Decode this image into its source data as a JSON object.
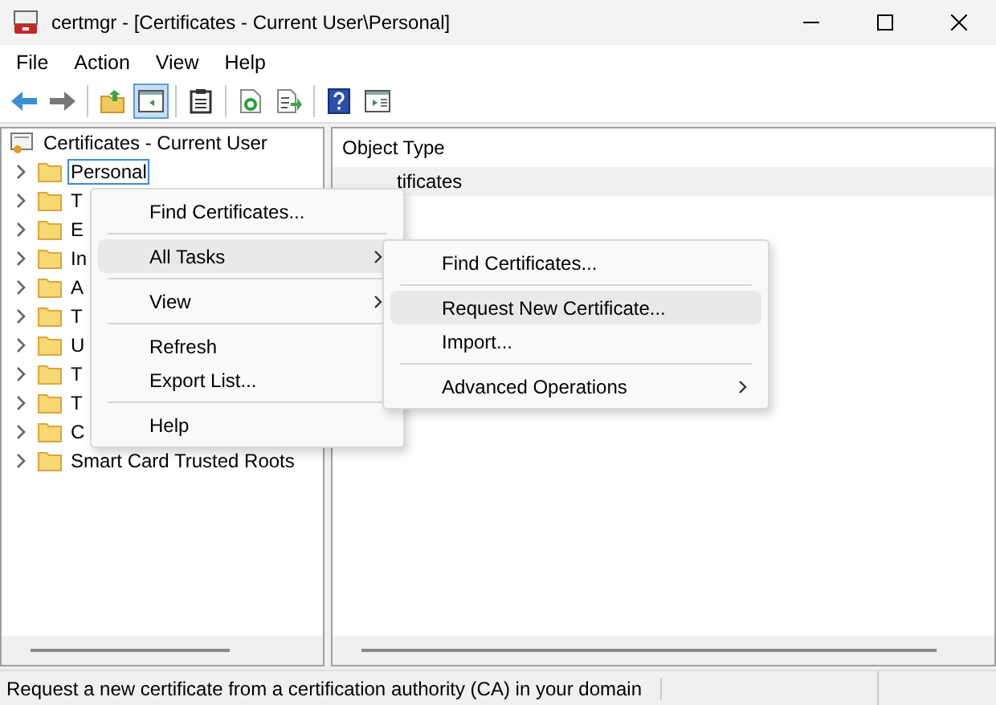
{
  "window": {
    "title": "certmgr - [Certificates - Current User\\Personal]"
  },
  "menu_bar": [
    {
      "label": "File"
    },
    {
      "label": "Action"
    },
    {
      "label": "View"
    },
    {
      "label": "Help"
    }
  ],
  "toolbar": [
    {
      "kind": "back",
      "pressed": false
    },
    {
      "kind": "forward",
      "pressed": false
    },
    {
      "kind": "separator"
    },
    {
      "kind": "up",
      "pressed": false
    },
    {
      "kind": "tree",
      "pressed": true
    },
    {
      "kind": "separator"
    },
    {
      "kind": "clipboard",
      "pressed": false
    },
    {
      "kind": "separator"
    },
    {
      "kind": "refresh",
      "pressed": false
    },
    {
      "kind": "export",
      "pressed": false
    },
    {
      "kind": "separator"
    },
    {
      "kind": "help",
      "pressed": false
    },
    {
      "kind": "pane",
      "pressed": false
    }
  ],
  "tree": {
    "root": "Certificates - Current User",
    "children": [
      {
        "label": "Personal",
        "selected": true
      },
      {
        "label": "T",
        "selected": false
      },
      {
        "label": "E",
        "selected": false
      },
      {
        "label": "In",
        "selected": false
      },
      {
        "label": "A",
        "selected": false
      },
      {
        "label": "T",
        "selected": false
      },
      {
        "label": "U",
        "selected": false
      },
      {
        "label": "T",
        "selected": false
      },
      {
        "label": "T",
        "selected": false
      },
      {
        "label": "C",
        "selected": false
      },
      {
        "label": "Smart Card Trusted Roots",
        "selected": false
      }
    ]
  },
  "list": {
    "columns": [
      "Object Type"
    ],
    "rows": [
      "tificates"
    ]
  },
  "context_menu": [
    {
      "kind": "item",
      "label": "Find Certificates...",
      "selected": false,
      "submenu": false
    },
    {
      "kind": "separator"
    },
    {
      "kind": "item",
      "label": "All Tasks",
      "selected": true,
      "submenu": true
    },
    {
      "kind": "separator"
    },
    {
      "kind": "item",
      "label": "View",
      "selected": false,
      "submenu": true
    },
    {
      "kind": "separator"
    },
    {
      "kind": "item",
      "label": "Refresh",
      "selected": false,
      "submenu": false
    },
    {
      "kind": "item",
      "label": "Export List...",
      "selected": false,
      "submenu": false
    },
    {
      "kind": "separator"
    },
    {
      "kind": "item",
      "label": "Help",
      "selected": false,
      "submenu": false
    }
  ],
  "submenu": [
    {
      "kind": "item",
      "label": "Find Certificates...",
      "selected": false,
      "submenu": false
    },
    {
      "kind": "separator"
    },
    {
      "kind": "item",
      "label": "Request New Certificate...",
      "selected": true,
      "submenu": false
    },
    {
      "kind": "item",
      "label": "Import...",
      "selected": false,
      "submenu": false
    },
    {
      "kind": "separator"
    },
    {
      "kind": "item",
      "label": "Advanced Operations",
      "selected": false,
      "submenu": true
    }
  ],
  "status_bar": "Request a new certificate from a certification authority (CA) in your domain"
}
